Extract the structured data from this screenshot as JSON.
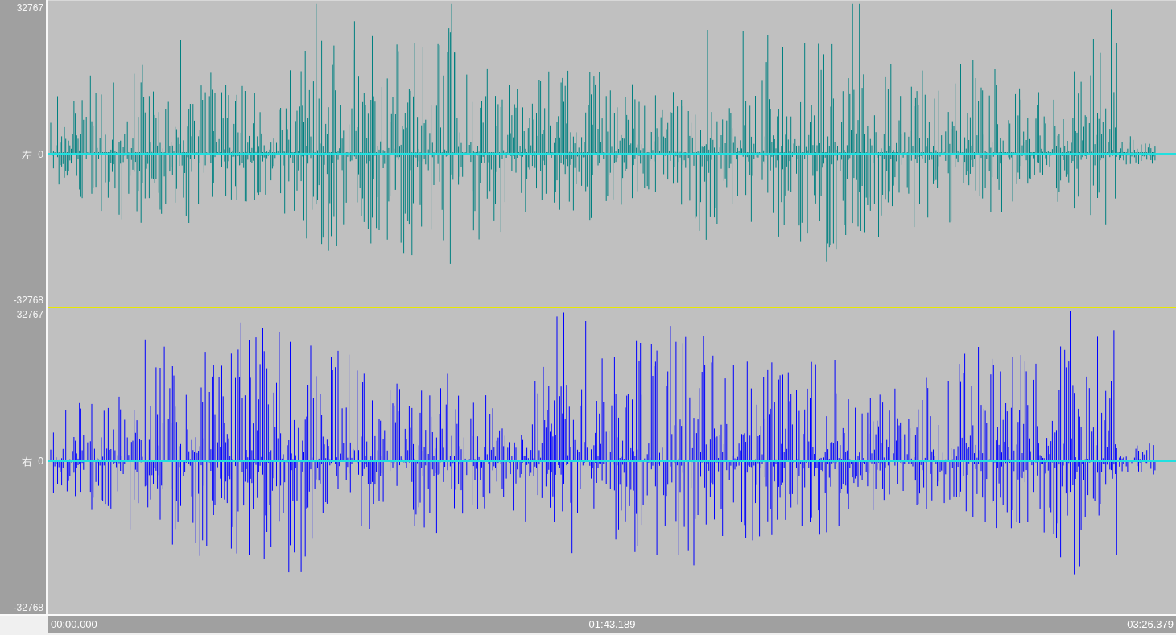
{
  "channels": [
    {
      "label": "左",
      "zero": "0",
      "max": "32767",
      "min": "-32768",
      "color": "#008080"
    },
    {
      "label": "右",
      "zero": "0",
      "max": "32767",
      "min": "-32768",
      "color": "#0000ff"
    }
  ],
  "timeline": {
    "start": "00:00.000",
    "middle": "01:43.189",
    "end": "03:26.379"
  }
}
